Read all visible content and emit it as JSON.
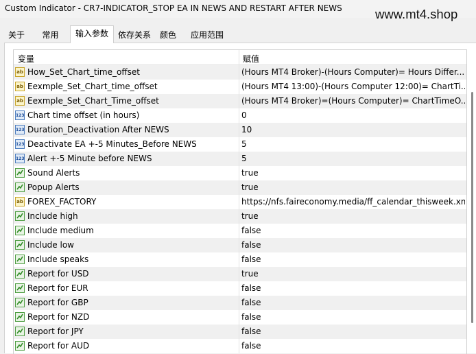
{
  "window": {
    "title": "Custom Indicator - CR7-INDICATOR_STOP EA IN NEWS AND RESTART AFTER NEWS"
  },
  "watermark": "www.mt4.shop",
  "tabs": [
    {
      "label": "关于"
    },
    {
      "label": "常用"
    },
    {
      "label": "输入参数",
      "active": true
    },
    {
      "label": "依存关系"
    },
    {
      "label": "颜色"
    },
    {
      "label": "应用范围"
    }
  ],
  "grid": {
    "header": {
      "name": "变量",
      "value": "赋值"
    },
    "rows": [
      {
        "icon": "string-icon",
        "name": "How_Set_Chart_time_offset",
        "value": "(Hours MT4 Broker)-(Hours Computer)= Hours Differ..."
      },
      {
        "icon": "string-icon",
        "name": "Eexmple_Set_Chart_time_offset",
        "value": "(Hours MT4 13:00)-(Hours Computer 12:00)= ChartTi..."
      },
      {
        "icon": "string-icon",
        "name": "Eexmple_Set_Chart_Time_offset",
        "value": "(Hours MT4 Broker)=(Hours Computer)= ChartTimeO..."
      },
      {
        "icon": "integer-icon",
        "name": "Chart time offset (in hours)",
        "value": "0"
      },
      {
        "icon": "integer-icon",
        "name": "Duration_Deactivation After NEWS",
        "value": "10"
      },
      {
        "icon": "integer-icon",
        "name": "Deactivate EA +-5  Minutes_Before NEWS",
        "value": "5"
      },
      {
        "icon": "integer-icon",
        "name": "Alert +-5 Minute before NEWS",
        "value": "5"
      },
      {
        "icon": "boolean-icon",
        "name": "Sound Alerts",
        "value": "true"
      },
      {
        "icon": "boolean-icon",
        "name": "Popup Alerts",
        "value": "true"
      },
      {
        "icon": "string-icon",
        "name": "FOREX_FACTORY",
        "value": "https://nfs.faireconomy.media/ff_calendar_thisweek.xml"
      },
      {
        "icon": "boolean-icon",
        "name": "Include high",
        "value": "true"
      },
      {
        "icon": "boolean-icon",
        "name": "Include medium",
        "value": "false"
      },
      {
        "icon": "boolean-icon",
        "name": "Include low",
        "value": "false"
      },
      {
        "icon": "boolean-icon",
        "name": "Include speaks",
        "value": "false"
      },
      {
        "icon": "boolean-icon",
        "name": "Report for USD",
        "value": "true"
      },
      {
        "icon": "boolean-icon",
        "name": "Report for EUR",
        "value": "false"
      },
      {
        "icon": "boolean-icon",
        "name": "Report for GBP",
        "value": "false"
      },
      {
        "icon": "boolean-icon",
        "name": "Report for NZD",
        "value": "false"
      },
      {
        "icon": "boolean-icon",
        "name": "Report for JPY",
        "value": "false"
      },
      {
        "icon": "boolean-icon",
        "name": "Report for AUD",
        "value": "false"
      }
    ]
  }
}
